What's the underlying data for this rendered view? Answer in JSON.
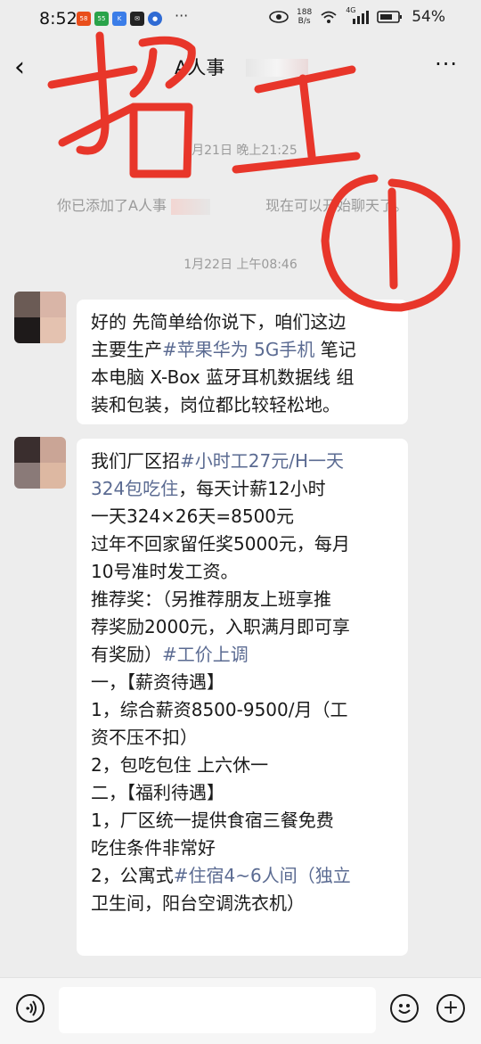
{
  "status_bar": {
    "time": "8:52",
    "app_icons": [
      "58",
      "55",
      "K",
      "✉",
      "●"
    ],
    "more": "···",
    "net_speed_top": "188",
    "net_speed_bottom": "B/s",
    "signal_label": "4G",
    "battery": "54%"
  },
  "header": {
    "back_icon": "‹",
    "title": "A人事",
    "menu_icon": "···"
  },
  "messages": {
    "timestamp_1": "1月21日 晚上21:25",
    "system_notice_a": "你已添加了A人事",
    "system_notice_b": "现在可以开始聊天了。",
    "timestamp_2": "1月22日 上午08:46",
    "bubble_1": {
      "lines": [
        "好的 先简单给你说下，咱们这边",
        "笔记",
        "本电脑 X-Box 蓝牙耳机数据线 组",
        "装和包装，岗位都比较轻松地。"
      ],
      "line2_prefix": "主要生产",
      "line2_tag": "#苹果华为 5G手机"
    },
    "bubble_2": {
      "l1_text": "我们厂区招",
      "l1_tag": "#小时工27元/H一天",
      "l2_tag": "324包吃住",
      "l2_text": "，每天计薪12小时",
      "l3": "一天324×26天=8500元",
      "l4": "过年不回家留任奖5000元，每月",
      "l5": "10号准时发工资。",
      "l6": "推荐奖：（另推荐朋友上班享推",
      "l7": "荐奖励2000元，入职满月即可享",
      "l8_text": "有奖励）",
      "l8_tag": "#工价上调",
      "l9": "一，【薪资待遇】",
      "l10": "1，综合薪资8500-9500/月（工",
      "l11": "资不压不扣）",
      "l12": "2，包吃包住 上六休一",
      "l13": "二，【福利待遇】",
      "l14": "1，厂区统一提供食宿三餐免费",
      "l15": "吃住条件非常好",
      "l16_text": "2，公寓式",
      "l16_tag": "#住宿4~6人间（独立",
      "l17": "卫生间，阳台空调洗衣机）"
    }
  },
  "input_bar": {
    "voice_icon": "voice",
    "emoji_icon": "emoji",
    "plus_icon": "+"
  },
  "colors": {
    "background": "#ededed",
    "bubble": "#ffffff",
    "hashtag": "#5b6b92",
    "annotation_red": "#e8362a"
  }
}
